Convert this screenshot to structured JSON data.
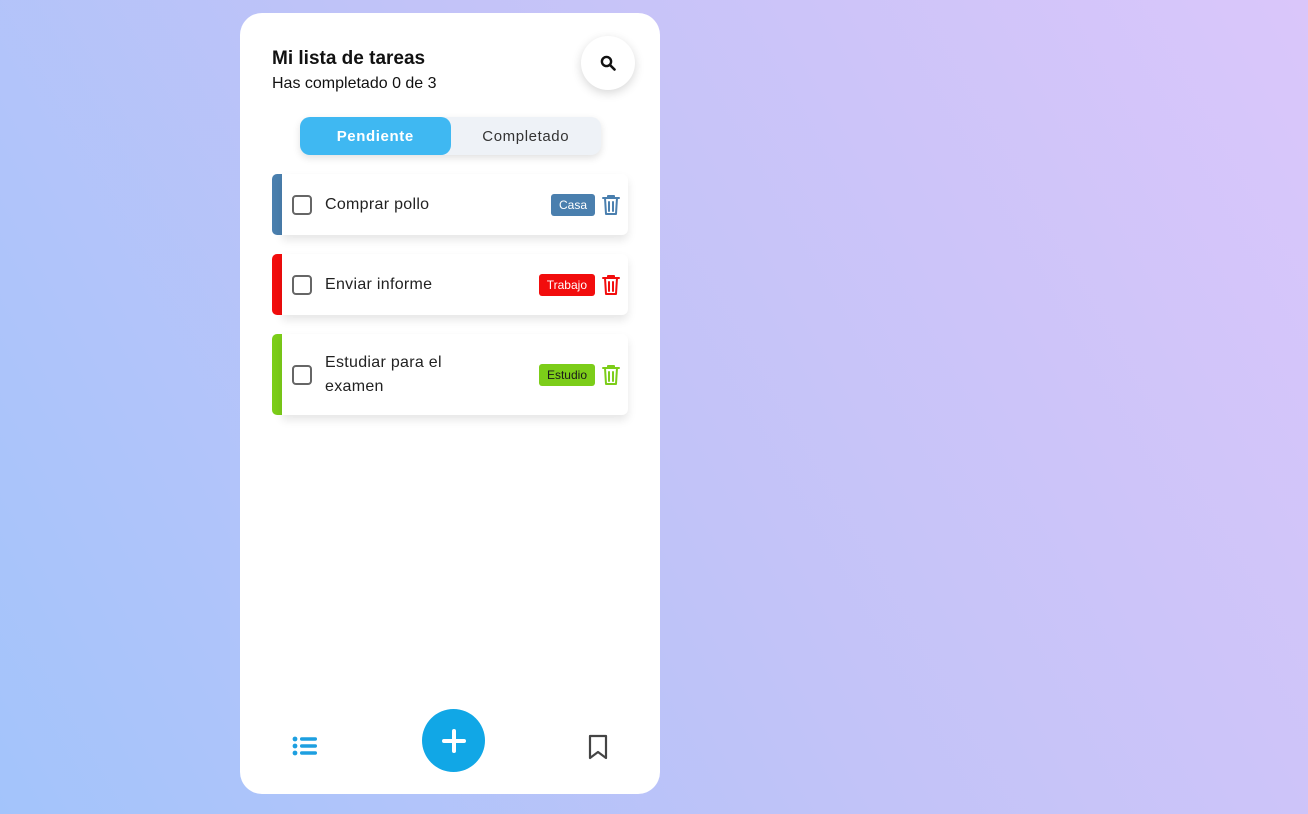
{
  "header": {
    "title": "Mi lista de tareas",
    "subtitle": "Has completado 0 de 3"
  },
  "tabs": [
    {
      "label": "Pendiente",
      "active": true
    },
    {
      "label": "Completado",
      "active": false
    }
  ],
  "tasks": [
    {
      "text": "Comprar pollo",
      "tag": "Casa",
      "color": "#4a7fae",
      "tag_text_color": "#ffffff",
      "checked": false
    },
    {
      "text": "Enviar informe",
      "tag": "Trabajo",
      "color": "#f20d0d",
      "tag_text_color": "#ffffff",
      "checked": false
    },
    {
      "text": "Estudiar para el examen",
      "tag": "Estudio",
      "color": "#7ccd19",
      "tag_text_color": "#1a1a1a",
      "checked": false
    }
  ],
  "icons": {
    "search": "search-icon",
    "delete": "trash-icon",
    "add": "plus-icon",
    "list": "list-icon",
    "bookmark": "bookmark-icon"
  },
  "colors": {
    "accent": "#3fb8f2",
    "fab": "#11a7e6"
  }
}
